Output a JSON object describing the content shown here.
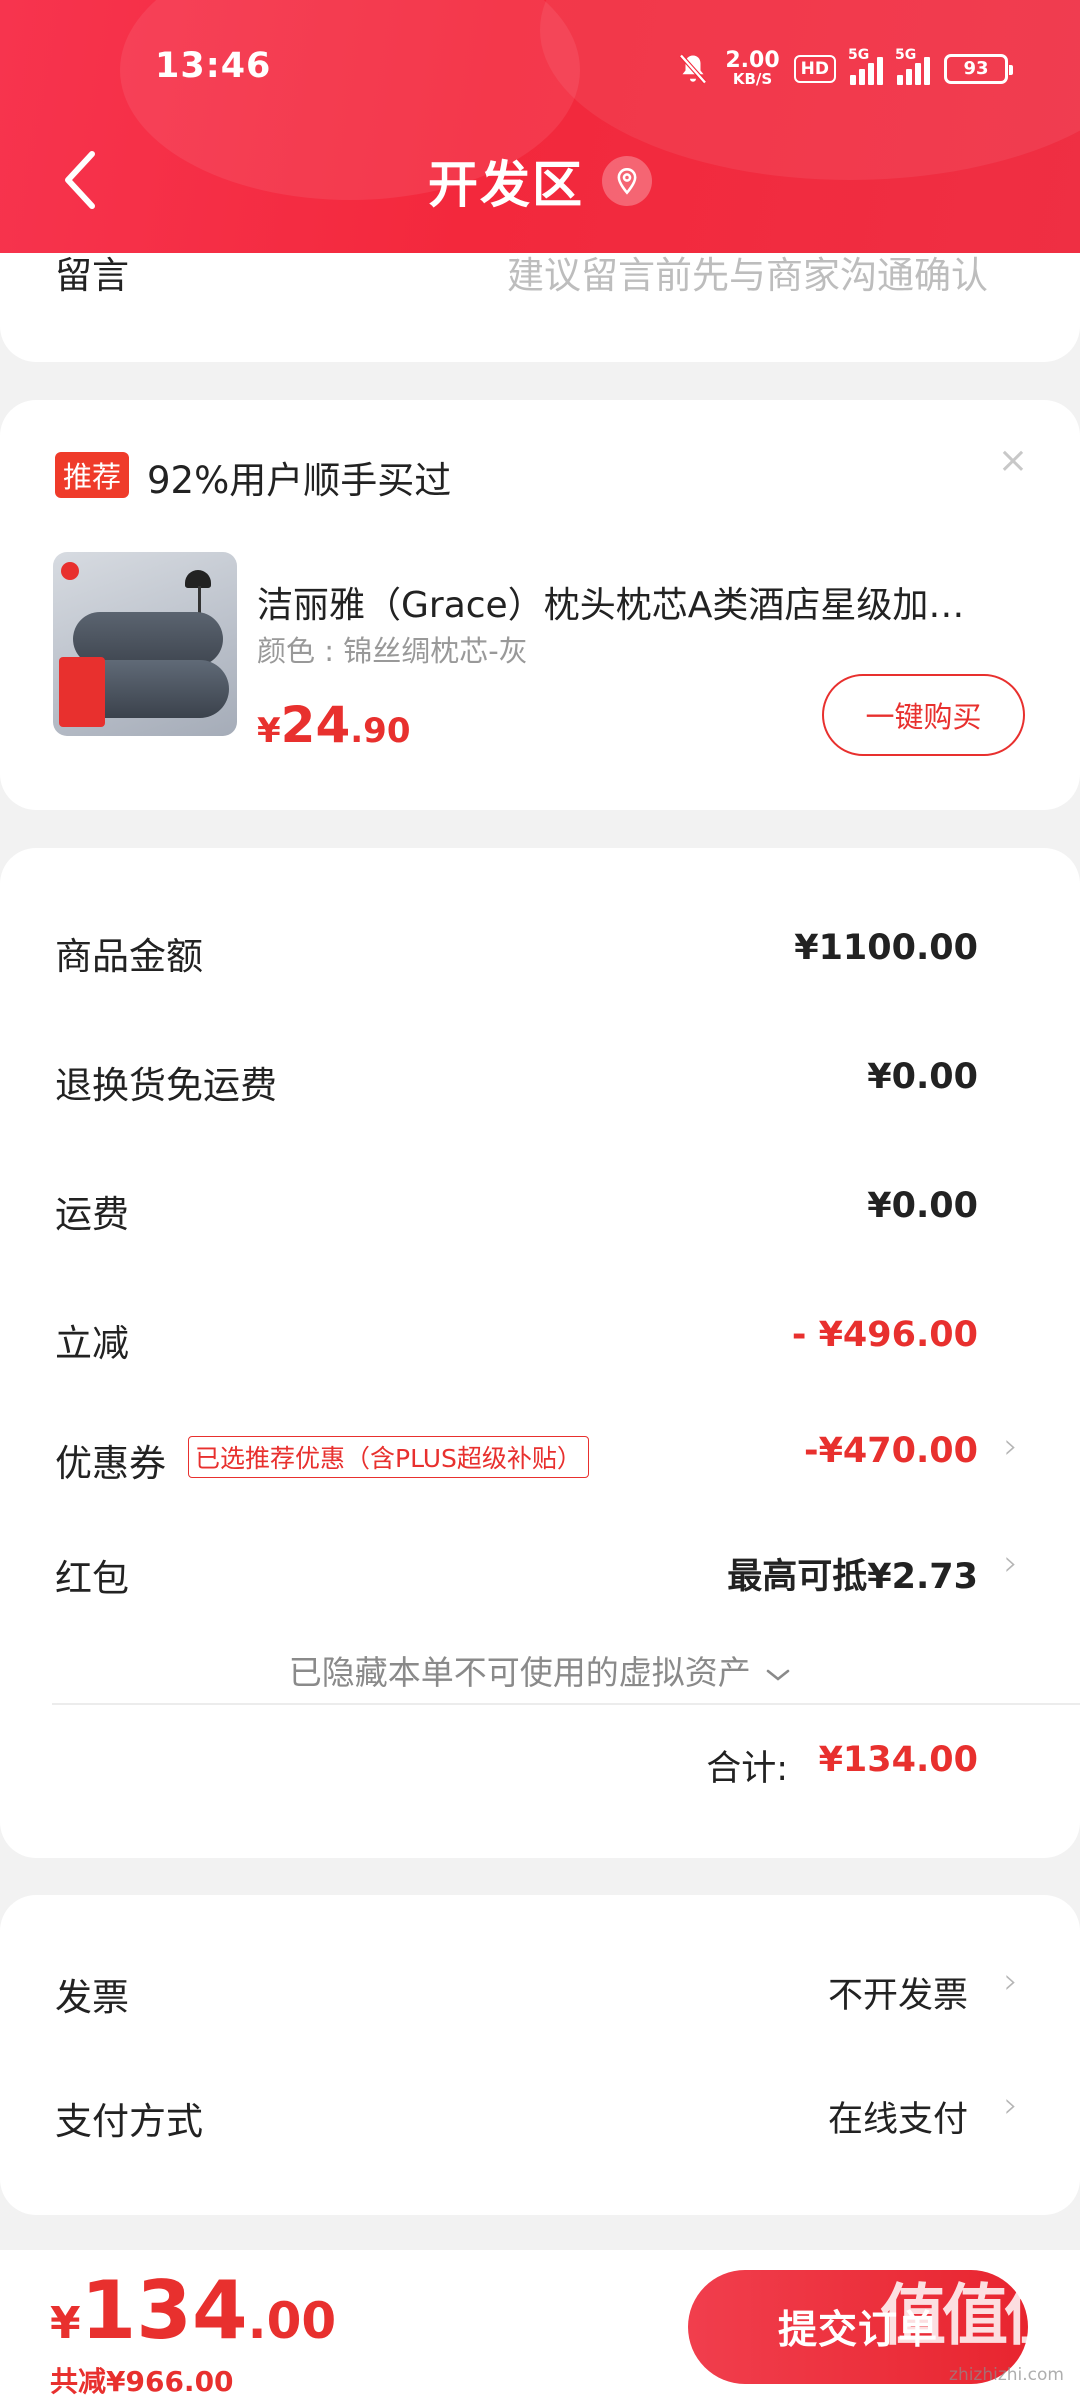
{
  "status_bar": {
    "time": "13:46",
    "net_speed_value": "2.00",
    "net_speed_unit": "KB/S",
    "hd_label": "HD",
    "signal1": "5G",
    "signal2": "5G",
    "battery": "93"
  },
  "header": {
    "title": "开发区"
  },
  "message": {
    "label": "留言",
    "placeholder": "建议留言前先与商家沟通确认"
  },
  "recommend": {
    "badge": "推荐",
    "title": "92%用户顺手买过",
    "close_symbol": "×",
    "product": {
      "name": "洁丽雅（Grace）枕头枕芯A类酒店星级加…",
      "variant": "颜色 : 锦丝绸枕芯-灰",
      "price_currency": "¥",
      "price_int": "24",
      "price_dec": ".90",
      "buy_label": "一键购买"
    }
  },
  "summary": {
    "rows": [
      {
        "label": "商品金额",
        "value": "¥1100.00"
      },
      {
        "label": "退换货免运费",
        "value": "¥0.00"
      },
      {
        "label": "运费",
        "value": "¥0.00"
      },
      {
        "label": "立减",
        "value": "- ¥496.00"
      },
      {
        "label": "优惠券",
        "tag": "已选推荐优惠（含PLUS超级补贴）",
        "value": "-¥470.00"
      },
      {
        "label": "红包",
        "value": "最高可抵¥2.73"
      }
    ],
    "hidden_assets": "已隐藏本单不可使用的虚拟资产",
    "total_label": "合计:",
    "total_value": "¥134.00",
    "chevron": "›"
  },
  "invoice": {
    "invoice_label": "发票",
    "invoice_value": "不开发票",
    "payment_label": "支付方式",
    "payment_value": "在线支付"
  },
  "bottom": {
    "currency": "¥",
    "amount_int": "134",
    "amount_dec": ".00",
    "saved": "共减¥966.00",
    "submit_label": "提交订单"
  },
  "watermark": {
    "text": "值值值",
    "sub": "zhizhizhi.com"
  },
  "colors": {
    "brand_red": "#e8302e",
    "header_red": "#f3283c"
  }
}
